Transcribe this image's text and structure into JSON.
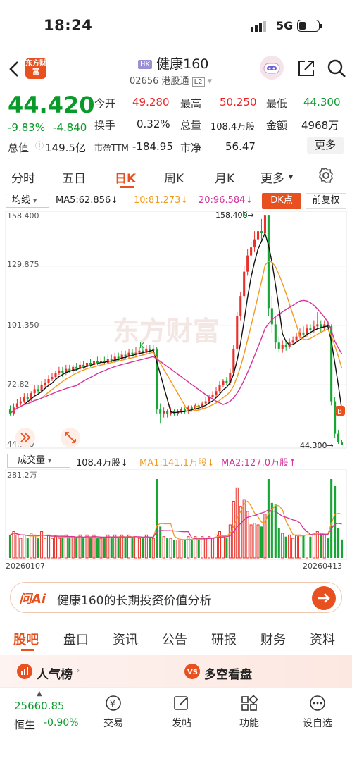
{
  "status": {
    "time": "18:24",
    "network": "5G"
  },
  "header": {
    "logo_text": "东方财富",
    "badge": "HK",
    "title": "健康160",
    "code": "02656",
    "connect": "港股通",
    "level": "L2"
  },
  "quote": {
    "price": "44.420",
    "change_pct": "-9.83%",
    "change": "-4.840",
    "open_label": "今开",
    "open": "49.280",
    "high_label": "最高",
    "high": "50.250",
    "low_label": "最低",
    "low": "44.300",
    "turnover_label": "换手",
    "turnover": "0.32%",
    "volume_label": "总量",
    "volume": "108.4万股",
    "amount_label": "金额",
    "amount": "4968万",
    "mcap_label": "总值",
    "mcap": "149.5亿",
    "pe_label": "市盈TTM",
    "pe": "-184.95",
    "pb_label": "市净",
    "pb": "56.47",
    "more": "更多"
  },
  "period_tabs": [
    "分时",
    "五日",
    "日K",
    "周K",
    "月K",
    "更多"
  ],
  "active_period": "日K",
  "ma_bar": {
    "selector": "均线",
    "ma5": "MA5:62.856↓",
    "ma10": "10:81.273↓",
    "ma20": "20:96.584↓",
    "dk": "DK点",
    "adjust": "前复权"
  },
  "chart_colors": {
    "up": "#e8312a",
    "down": "#17a534",
    "ma5": "#111111",
    "ma10": "#f39a1e",
    "ma20": "#d6339b"
  },
  "chart_data": {
    "type": "candlestick",
    "y_ticks": [
      "158.400",
      "129.875",
      "101.350",
      "72.82",
      "44.300"
    ],
    "ylim": [
      44.3,
      158.4
    ],
    "high_label": "158.400→",
    "low_label": "44.300→",
    "markers": [
      "K",
      "K",
      "D"
    ],
    "watermark": "东方财富",
    "candles": [
      [
        62,
        60,
        64,
        59
      ],
      [
        60,
        63,
        65,
        59
      ],
      [
        63,
        65,
        67,
        62
      ],
      [
        65,
        66,
        68,
        64
      ],
      [
        66,
        68,
        70,
        65
      ],
      [
        68,
        67,
        70,
        66
      ],
      [
        67,
        70,
        71,
        66
      ],
      [
        70,
        72,
        74,
        69
      ],
      [
        72,
        71,
        74,
        70
      ],
      [
        71,
        74,
        76,
        70
      ],
      [
        74,
        75,
        77,
        73
      ],
      [
        75,
        77,
        79,
        74
      ],
      [
        77,
        78,
        80,
        76
      ],
      [
        78,
        80,
        81,
        77
      ],
      [
        80,
        81,
        83,
        79
      ],
      [
        81,
        80,
        83,
        78
      ],
      [
        80,
        82,
        84,
        79
      ],
      [
        82,
        81,
        84,
        80
      ],
      [
        81,
        83,
        84,
        80
      ],
      [
        83,
        82,
        85,
        81
      ],
      [
        82,
        84,
        86,
        81
      ],
      [
        84,
        83,
        86,
        82
      ],
      [
        83,
        85,
        87,
        82
      ],
      [
        85,
        84,
        87,
        83
      ],
      [
        84,
        86,
        88,
        83
      ],
      [
        86,
        85,
        88,
        84
      ],
      [
        85,
        86,
        88,
        84
      ],
      [
        86,
        85,
        88,
        84
      ],
      [
        85,
        87,
        89,
        84
      ],
      [
        87,
        86,
        89,
        85
      ],
      [
        86,
        88,
        90,
        85
      ],
      [
        88,
        87,
        90,
        86
      ],
      [
        87,
        89,
        91,
        86
      ],
      [
        89,
        88,
        91,
        87
      ],
      [
        88,
        90,
        92,
        87
      ],
      [
        90,
        89,
        92,
        88
      ],
      [
        89,
        90,
        93,
        88
      ],
      [
        90,
        91,
        93,
        89
      ],
      [
        91,
        90,
        93,
        89
      ],
      [
        90,
        92,
        94,
        89
      ],
      [
        92,
        91,
        94,
        90
      ],
      [
        91,
        92,
        94,
        90
      ],
      [
        92,
        62,
        93,
        60
      ],
      [
        62,
        60,
        65,
        55
      ],
      [
        60,
        61,
        63,
        58
      ],
      [
        61,
        60,
        62,
        58
      ],
      [
        60,
        61,
        63,
        59
      ],
      [
        61,
        60,
        62,
        59
      ],
      [
        60,
        61,
        62,
        59
      ],
      [
        61,
        62,
        63,
        60
      ],
      [
        62,
        61,
        63,
        60
      ],
      [
        61,
        63,
        64,
        60
      ],
      [
        63,
        62,
        64,
        61
      ],
      [
        62,
        64,
        65,
        61
      ],
      [
        64,
        63,
        65,
        62
      ],
      [
        63,
        65,
        66,
        62
      ],
      [
        65,
        66,
        68,
        64
      ],
      [
        66,
        68,
        69,
        65
      ],
      [
        68,
        69,
        71,
        67
      ],
      [
        69,
        71,
        73,
        68
      ],
      [
        71,
        74,
        76,
        70
      ],
      [
        74,
        76,
        77,
        73
      ],
      [
        76,
        75,
        78,
        74
      ],
      [
        75,
        80,
        82,
        74
      ],
      [
        80,
        92,
        94,
        79
      ],
      [
        92,
        108,
        110,
        91
      ],
      [
        108,
        118,
        120,
        106
      ],
      [
        118,
        130,
        133,
        117
      ],
      [
        130,
        138,
        141,
        128
      ],
      [
        138,
        142,
        145,
        136
      ],
      [
        142,
        146,
        150,
        140
      ],
      [
        146,
        150,
        153,
        144
      ],
      [
        150,
        149,
        156,
        145
      ],
      [
        149,
        158,
        158.4,
        148
      ],
      [
        158,
        112,
        158,
        108
      ],
      [
        112,
        104,
        118,
        100
      ],
      [
        104,
        95,
        108,
        92
      ],
      [
        95,
        92,
        98,
        90
      ],
      [
        92,
        94,
        96,
        90
      ],
      [
        94,
        93,
        96,
        91
      ],
      [
        93,
        95,
        97,
        92
      ],
      [
        95,
        96,
        98,
        94
      ],
      [
        96,
        98,
        100,
        95
      ],
      [
        98,
        100,
        102,
        97
      ],
      [
        100,
        99,
        103,
        97
      ],
      [
        99,
        102,
        104,
        98
      ],
      [
        102,
        101,
        104,
        99
      ],
      [
        101,
        103,
        106,
        100
      ],
      [
        103,
        104,
        110,
        102
      ],
      [
        104,
        102,
        106,
        100
      ],
      [
        102,
        104,
        106,
        101
      ],
      [
        104,
        103,
        106,
        102
      ],
      [
        103,
        66,
        104,
        64
      ],
      [
        66,
        50,
        68,
        48
      ],
      [
        50,
        46,
        52,
        45
      ],
      [
        46,
        44.4,
        47,
        44.3
      ]
    ],
    "volume": {
      "max_label": "281.2万",
      "ma_bar": {
        "selector": "成交量",
        "vol": "108.4万股↓",
        "ma1": "MA1:141.1万股↓",
        "ma2": "MA2:127.0万股↑"
      },
      "x_start": "20260107",
      "x_end": "20260413"
    }
  },
  "ai": {
    "logo": "问Ai",
    "text": "健康160的长期投资价值分析"
  },
  "bottom_tabs": [
    "股吧",
    "盘口",
    "资讯",
    "公告",
    "研报",
    "财务",
    "资料"
  ],
  "active_bottom_tab": "股吧",
  "cards": {
    "hot": "人气榜",
    "vs": "多空看盘"
  },
  "bottom_nav": {
    "index_value": "25660.85",
    "index_name": "恒生",
    "index_change": "-0.90%",
    "items": [
      "交易",
      "发帖",
      "功能",
      "设自选"
    ]
  }
}
